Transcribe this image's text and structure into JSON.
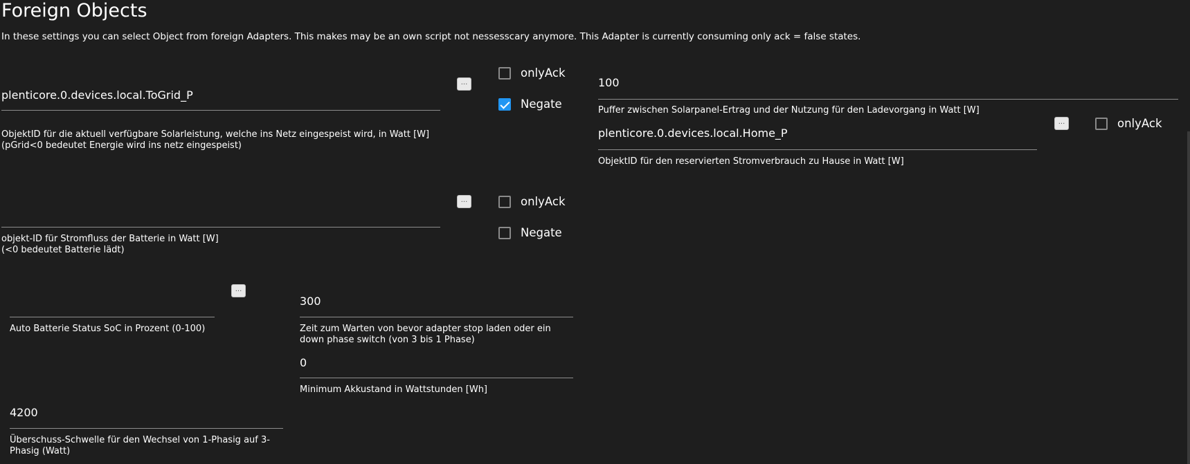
{
  "header": {
    "title": "Foreign Objects",
    "description": "In these settings you can select Object from foreign Adapters. This makes may be an own script not nessesscary anymore. This Adapter is currently consuming only ack = false states."
  },
  "select_button_label": "...",
  "grid_power": {
    "value": "plenticore.0.devices.local.ToGrid_P",
    "helper": "ObjektID für die aktuell verfügbare Solarleistung, welche ins Netz eingespeist wird, in Watt [W] (pGrid<0 bedeutet Energie wird ins netz eingespeist)",
    "only_ack_label": "onlyAck",
    "only_ack_checked": false,
    "negate_label": "Negate",
    "negate_checked": true
  },
  "buffer": {
    "value": "100",
    "helper": "Puffer zwischen Solarpanel-Ertrag und der Nutzung für den Ladevorgang in Watt [W]"
  },
  "home_power": {
    "value": "plenticore.0.devices.local.Home_P",
    "helper": "ObjektID für den reservierten Stromverbrauch zu Hause in Watt [W]",
    "only_ack_label": "onlyAck",
    "only_ack_checked": false
  },
  "battery_power": {
    "value": "",
    "helper_line1": "objekt-ID für Stromfluss der Batterie in Watt [W]",
    "helper_line2": "(<0 bedeutet Batterie lädt)",
    "only_ack_label": "onlyAck",
    "only_ack_checked": false,
    "negate_label": "Negate",
    "negate_checked": false
  },
  "car_soc": {
    "value": "",
    "helper": "Auto Batterie Status SoC in Prozent (0-100)"
  },
  "wait_time": {
    "value": "300",
    "helper": "Zeit zum Warten von bevor adapter stop laden oder ein down phase switch (von 3 bis 1 Phase)"
  },
  "min_battery": {
    "value": "0",
    "helper": "Minimum Akkustand in Wattstunden [Wh]"
  },
  "phase_threshold": {
    "value": "4200",
    "helper": "Überschuss-Schwelle für den Wechsel von 1-Phasig auf 3-Phasig (Watt)"
  },
  "colors": {
    "background": "#1e1e1e",
    "accent": "#2196f3",
    "underline": "#8e8e8e"
  }
}
